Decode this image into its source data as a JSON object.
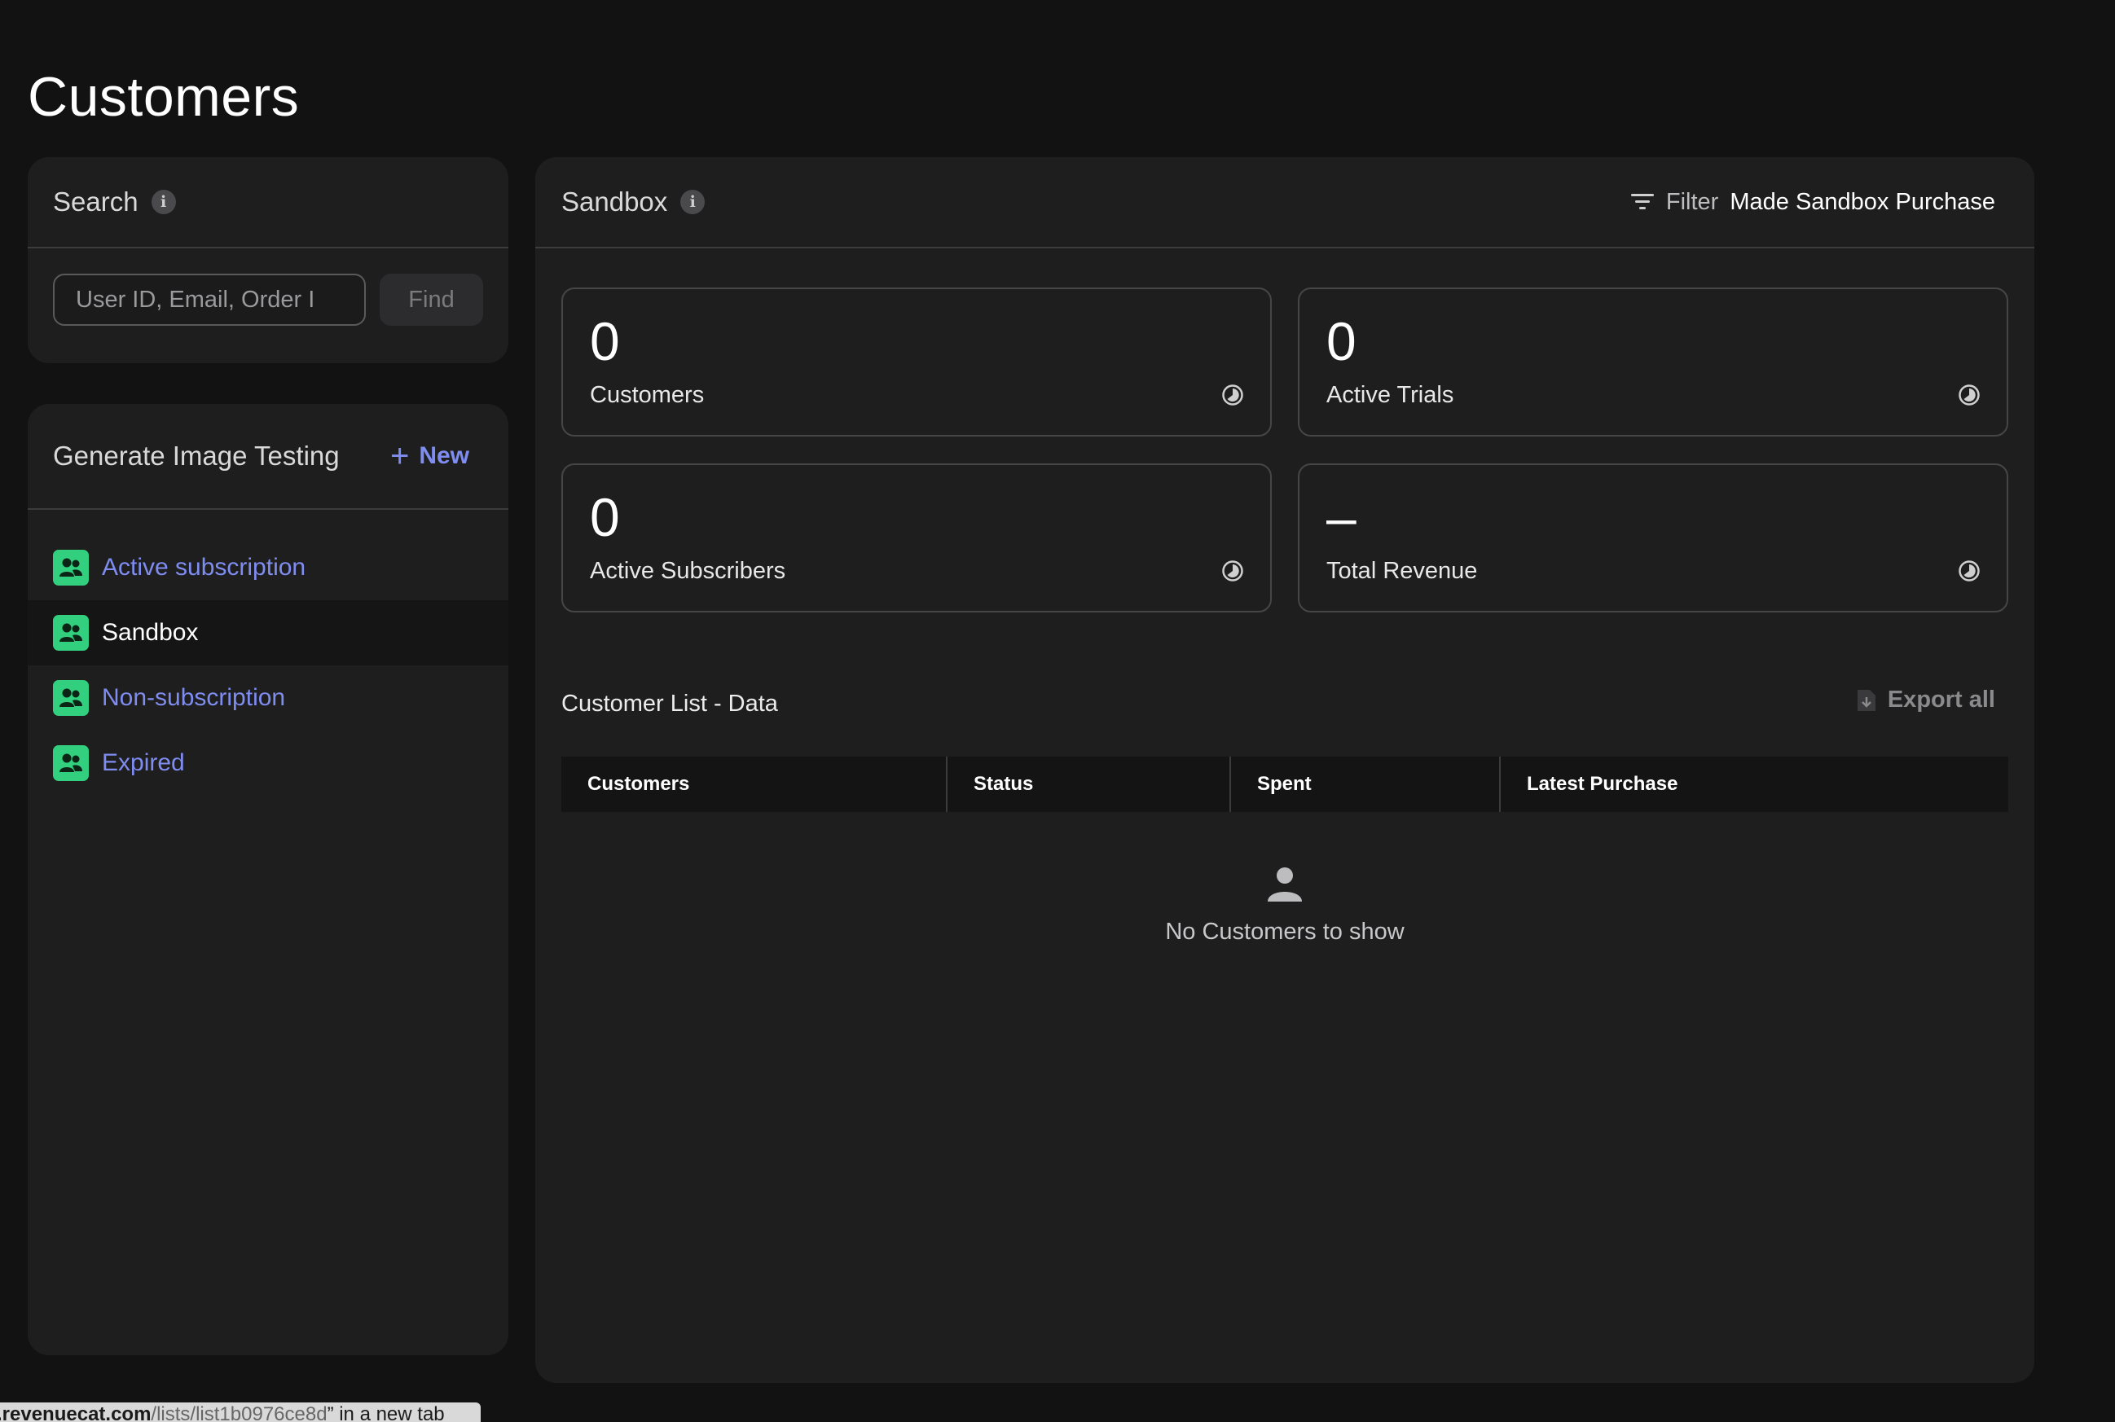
{
  "page": {
    "title": "Customers"
  },
  "search": {
    "title": "Search",
    "placeholder": "User ID, Email, Order I",
    "find_label": "Find"
  },
  "lists": {
    "title": "Generate Image Testing",
    "new_label": "New",
    "items": [
      {
        "label": "Active subscription",
        "icon": "people-icon",
        "selected": false
      },
      {
        "label": "Sandbox",
        "icon": "people-icon",
        "selected": true
      },
      {
        "label": "Non-subscription",
        "icon": "people-icon",
        "selected": false
      },
      {
        "label": "Expired",
        "icon": "people-icon",
        "selected": false
      }
    ]
  },
  "main": {
    "title": "Sandbox",
    "filter_label": "Filter",
    "filter_value": "Made Sandbox Purchase",
    "stats": [
      {
        "value": "0",
        "label": "Customers"
      },
      {
        "value": "0",
        "label": "Active Trials"
      },
      {
        "value": "0",
        "label": "Active Subscribers"
      },
      {
        "value": "–",
        "label": "Total Revenue"
      }
    ],
    "section_title": "Customer List - Data",
    "export_label": "Export all",
    "table": {
      "columns": [
        "Customers",
        "Status",
        "Spent",
        "Latest Purchase"
      ]
    },
    "empty_text": "No Customers to show"
  },
  "status_bar": {
    "text_domain": ".revenuecat.com",
    "text_path": "/lists/list1b0976ce8d",
    "text_suffix": "” in a new tab"
  },
  "colors": {
    "background": "#121213",
    "panel": "#1e1e1f",
    "accent": "#7f8cf0",
    "icon_green": "#31cf7e"
  }
}
